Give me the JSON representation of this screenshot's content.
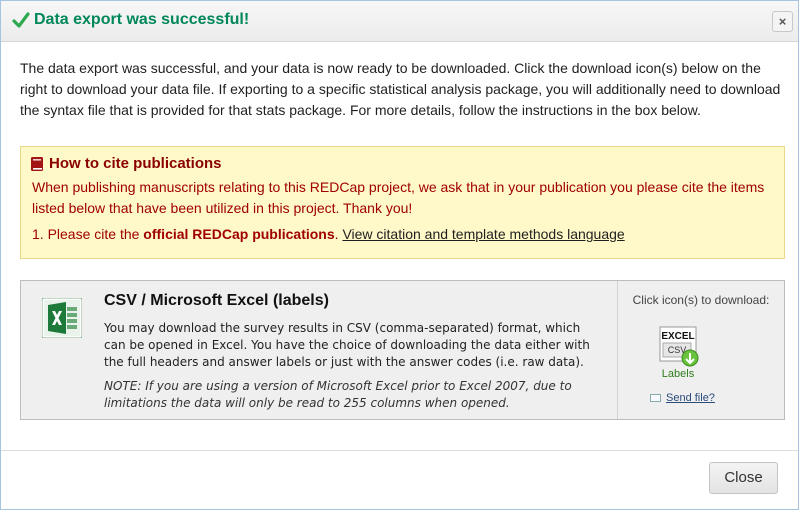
{
  "dialog": {
    "title": "Data export was successful!",
    "close_x": "×",
    "intro": "The data export was successful, and your data is now ready to be downloaded. Click the download icon(s) below on the right to download your data file. If exporting to a specific statistical analysis package, you will additionally need to download the syntax file that is provided for that stats package. For more details, follow the instructions in the box below."
  },
  "cite": {
    "title": "How to cite publications",
    "body": "When publishing manuscripts relating to this REDCap project, we ask that in your publication you please cite the items listed below that have been utilized in this project. Thank you!",
    "item_prefix": "1. Please cite the",
    "item_bold": "official REDCap publications",
    "item_period": ".",
    "item_link": "View citation and template methods language"
  },
  "export": {
    "title": "CSV / Microsoft Excel (labels)",
    "description": "You may download the survey results in CSV (comma-separated) format, which can be opened in Excel. You have the choice of downloading the data either with the full headers and answer labels or just with the answer codes (i.e. raw data).",
    "note": "NOTE: If you are using a version of Microsoft Excel prior to Excel 2007, due to limitations the data will only be read to 255 columns when opened.",
    "download_label": "Click icon(s) to download:",
    "icon_text_top": "EXCEL",
    "icon_text_mid": "CSV",
    "icon_text_bottom": "Labels",
    "send_file": "Send file?"
  },
  "footer": {
    "close_button": "Close"
  },
  "colors": {
    "success": "#00875a",
    "cite_title": "#8a0000",
    "cite_text": "#a00000",
    "cite_bg": "#fff9c9",
    "excel_green": "#1e7a3a"
  },
  "icons": [
    "check-icon",
    "close-icon",
    "book-icon",
    "excel-icon",
    "csv-download-icon",
    "mail-icon"
  ]
}
